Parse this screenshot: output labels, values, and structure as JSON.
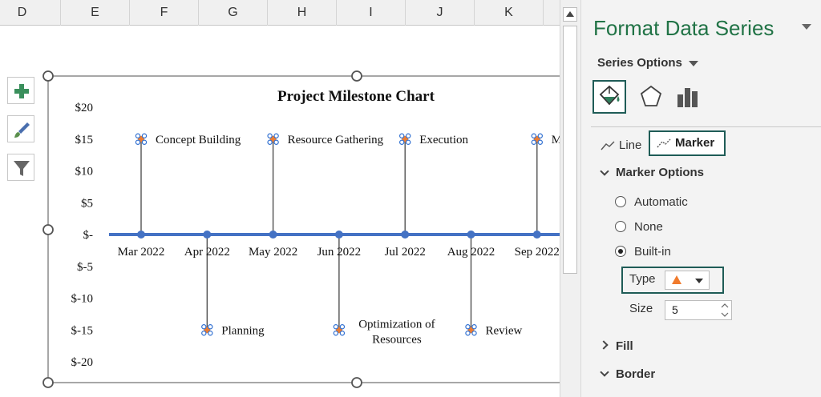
{
  "sheet": {
    "columns": [
      "D",
      "E",
      "F",
      "G",
      "H",
      "I",
      "J",
      "K"
    ]
  },
  "chart": {
    "side_buttons": [
      {
        "name": "chart-elements-button",
        "icon": "plus-icon"
      },
      {
        "name": "chart-styles-button",
        "icon": "brush-icon"
      },
      {
        "name": "chart-filters-button",
        "icon": "filter-icon"
      }
    ]
  },
  "chart_data": {
    "type": "scatter",
    "title": "Project Milestone Chart",
    "y_ticks": [
      "$20",
      "$15",
      "$10",
      "$5",
      "$-",
      "$-5",
      "$-10",
      "$-15",
      "$-20"
    ],
    "ylim": [
      -20,
      20
    ],
    "x": [
      "Mar 2022",
      "Apr 2022",
      "May 2022",
      "Jun 2022",
      "Jul 2022",
      "Aug 2022",
      "Sep 2022"
    ],
    "milestones": [
      {
        "date": "Mar 2022",
        "value": 15,
        "label": "Concept Building"
      },
      {
        "date": "Apr 2022",
        "value": -15,
        "label": "Planning"
      },
      {
        "date": "May 2022",
        "value": 15,
        "label": "Resource Gathering"
      },
      {
        "date": "Jun 2022",
        "value": -15,
        "label": "Optimization of Resources",
        "label_lines": [
          "Optimization of",
          "Resources"
        ]
      },
      {
        "date": "Jul 2022",
        "value": 15,
        "label": "Execution"
      },
      {
        "date": "Aug 2022",
        "value": -15,
        "label": "Review"
      },
      {
        "date": "Sep 2022",
        "value": 15,
        "label": "M"
      }
    ],
    "line_color": "#4472c4",
    "marker_color": "#ed7d31",
    "grid": false
  },
  "pane": {
    "title": "Format Data Series",
    "series_options": "Series Options",
    "tabs": {
      "fill_icon": "paint-bucket-icon",
      "effects_icon": "pentagon-icon",
      "series_icon": "bar-chart-icon"
    },
    "line_tab": "Line",
    "marker_tab": "Marker",
    "marker_options": "Marker Options",
    "radio": {
      "automatic": "Automatic",
      "none": "None",
      "builtin": "Built-in",
      "selected": "Built-in"
    },
    "type_label": "Type",
    "type_value": "triangle",
    "size_label": "Size",
    "size_value": "5",
    "fill_section": "Fill",
    "border_section": "Border",
    "accent": "#217346",
    "selected_border": "#1f5c57"
  }
}
